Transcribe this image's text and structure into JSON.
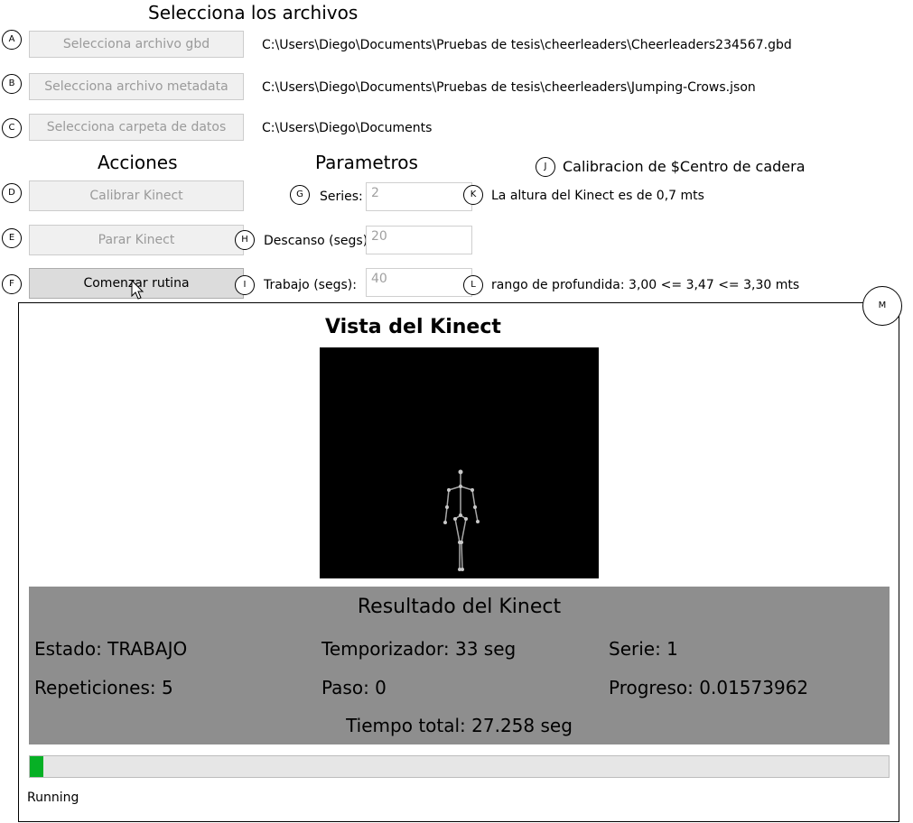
{
  "header": {
    "title": "Selecciona los archivos"
  },
  "files": {
    "gbd_button": "Selecciona archivo gbd",
    "gbd_path": "C:\\Users\\Diego\\Documents\\Pruebas de tesis\\cheerleaders\\Cheerleaders234567.gbd",
    "metadata_button": "Selecciona archivo metadata",
    "metadata_path": "C:\\Users\\Diego\\Documents\\Pruebas de tesis\\cheerleaders\\Jumping-Crows.json",
    "folder_button": "Selecciona carpeta de datos",
    "folder_path": "C:\\Users\\Diego\\Documents"
  },
  "actions": {
    "heading": "Acciones",
    "calibrate": "Calibrar Kinect",
    "stop": "Parar Kinect",
    "start": "Comenzar rutina"
  },
  "params": {
    "heading": "Parametros",
    "series_label": "Series:",
    "series_value": "2",
    "rest_label": "Descanso (segs)",
    "rest_value": "20",
    "work_label": "Trabajo (segs):",
    "work_value": "40"
  },
  "calibration": {
    "title": "Calibracion de $Centro de cadera",
    "height_text": "La altura del Kinect es de 0,7 mts",
    "depth_text": "rango de profundida: 3,00 <= 3,47 <= 3,30 mts"
  },
  "markers": {
    "a": "A",
    "b": "B",
    "c": "C",
    "d": "D",
    "e": "E",
    "f": "F",
    "g": "G",
    "h": "H",
    "i": "I",
    "j": "J",
    "k": "K",
    "l": "L",
    "m": "M"
  },
  "view": {
    "title": "Vista del Kinect"
  },
  "results": {
    "title": "Resultado del Kinect",
    "estado": "Estado: TRABAJO",
    "temporizador": "Temporizador: 33 seg",
    "serie": "Serie: 1",
    "repeticiones": "Repeticiones: 5",
    "paso": "Paso: 0",
    "progreso": "Progreso: 0.01573962",
    "total": "Tiempo total: 27.258 seg"
  },
  "progress": {
    "fraction": 0.0157
  },
  "status": {
    "text": "Running"
  },
  "colors": {
    "results_bg": "#8e8e8e",
    "view_bg": "#000000",
    "skeleton": "#a8a8a8"
  }
}
